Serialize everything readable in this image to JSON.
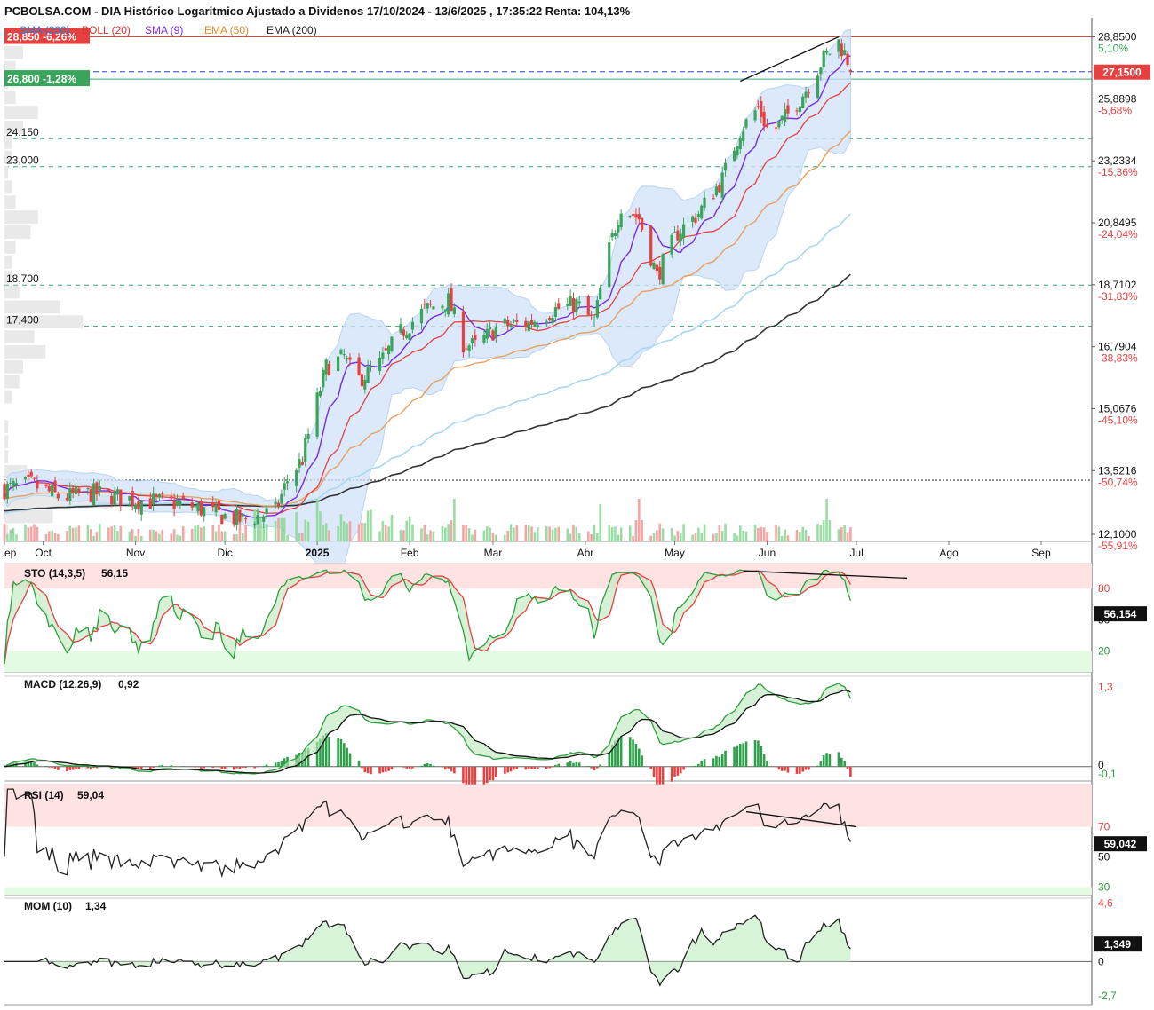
{
  "header": {
    "title": "PCBOLSA.COM - DIA Histórico Logaritmico Ajustado a Dividenos 17/10/2024 - 13/6/2025 , 17:35:22 Renta: 104,13%",
    "indicators": [
      {
        "label": "SMA (200)",
        "color": "#2a7fd4"
      },
      {
        "label": "BOLL (20)",
        "color": "#d6332f"
      },
      {
        "label": "SMA (9)",
        "color": "#7a2be2"
      },
      {
        "label": "EMA (50)",
        "color": "#e08a2a"
      },
      {
        "label": "EMA (200)",
        "color": "#222222"
      }
    ]
  },
  "colors": {
    "up": "#3aa55a",
    "down": "#e64040",
    "sma9": "#7a2be2",
    "boll_mid": "#e64040",
    "boll_band": "#cfe2f8",
    "ema50": "#e8a060",
    "sma200": "#a8d8f0",
    "ema200": "#333333",
    "stoch_k": "#2e9e3e",
    "stoch_d": "#e64040",
    "overbought": "#ffe3e3",
    "oversold": "#e3fbe3",
    "level_line": "#3aa57a"
  },
  "price_tags": {
    "resistance": {
      "price": 28.85,
      "text": "28,850 -6,26%",
      "color": "#e64040"
    },
    "support": {
      "price": 26.8,
      "text": "26,800 -1,28%",
      "color": "#3aa55a"
    },
    "last": {
      "price": 27.15,
      "text": "27,1500",
      "color": "#e64040"
    }
  },
  "levels": [
    {
      "price": 24.15,
      "text": "24,150"
    },
    {
      "price": 23.0,
      "text": "23,000"
    },
    {
      "price": 18.7,
      "text": "18,700"
    },
    {
      "price": 17.4,
      "text": "17,400"
    }
  ],
  "base_line": 13.3,
  "right_axis": [
    {
      "price": 28.85,
      "value": "28,8500",
      "pct": "5,10%",
      "pct_color": "#3aa55a"
    },
    {
      "price": 25.8898,
      "value": "25,8898",
      "pct": "-5,68%",
      "pct_color": "#e64040"
    },
    {
      "price": 23.2334,
      "value": "23,2334",
      "pct": "-15,36%",
      "pct_color": "#e64040"
    },
    {
      "price": 20.8495,
      "value": "20,8495",
      "pct": "-24,04%",
      "pct_color": "#e64040"
    },
    {
      "price": 18.7102,
      "value": "18,7102",
      "pct": "-31,83%",
      "pct_color": "#e64040"
    },
    {
      "price": 16.7904,
      "value": "16,7904",
      "pct": "-38,83%",
      "pct_color": "#e64040"
    },
    {
      "price": 15.0676,
      "value": "15,0676",
      "pct": "-45,10%",
      "pct_color": "#e64040"
    },
    {
      "price": 13.5216,
      "value": "13,5216",
      "pct": "-50,74%",
      "pct_color": "#e64040"
    },
    {
      "price": 12.1,
      "value": "12,1000",
      "pct": "-55,91%",
      "pct_color": "#e64040"
    }
  ],
  "x_axis": [
    {
      "label": "ep",
      "day": 0
    },
    {
      "label": "Oct",
      "day": 13
    },
    {
      "label": "Nov",
      "day": 44
    },
    {
      "label": "Dic",
      "day": 74
    },
    {
      "label": "2025",
      "day": 105,
      "bold": true
    },
    {
      "label": "Feb",
      "day": 136
    },
    {
      "label": "Mar",
      "day": 164
    },
    {
      "label": "Abr",
      "day": 195
    },
    {
      "label": "May",
      "day": 225
    },
    {
      "label": "Jun",
      "day": 256
    },
    {
      "label": "Jul",
      "day": 286
    },
    {
      "label": "Ago",
      "day": 317
    },
    {
      "label": "Sep",
      "day": 348
    }
  ],
  "panels": {
    "sto": {
      "label": "STO (14,3,5)",
      "value": "56,15",
      "tag": "56,154",
      "levels": [
        "80",
        "50",
        "20"
      ],
      "level_values": [
        80,
        50,
        20
      ]
    },
    "macd": {
      "label": "MACD (12,26,9)",
      "value": "0,92",
      "axis": [
        "1,3",
        "0",
        "-0,1"
      ],
      "axis_values": [
        1.3,
        0,
        -0.1
      ]
    },
    "rsi": {
      "label": "RSI (14)",
      "value": "59,04",
      "tag": "59,042",
      "levels": [
        "70",
        "50",
        "30"
      ],
      "level_values": [
        70,
        50,
        30
      ]
    },
    "mom": {
      "label": "MOM (10)",
      "value": "1,34",
      "tag": "1,349",
      "axis": [
        "4,6",
        "0",
        "-2,7"
      ],
      "axis_values": [
        4.6,
        0,
        -2.7
      ]
    }
  },
  "chart_data": {
    "type": "candlestick",
    "title": "PCBOLSA.COM - DIA Histórico Logaritmico Ajustado a Dividenos 17/10/2024 - 13/6/2025 , 17:35:22 Renta: 104,13%",
    "y_scale": "log",
    "ylim": [
      12.1,
      28.85
    ],
    "anchors": [
      {
        "date": "2024-09-01",
        "close": 13.1
      },
      {
        "date": "2024-09-10",
        "close": 13.2
      },
      {
        "date": "2024-09-20",
        "close": 12.9
      },
      {
        "date": "2024-10-01",
        "close": 13.0
      },
      {
        "date": "2024-10-15",
        "close": 12.85
      },
      {
        "date": "2024-11-01",
        "close": 12.75
      },
      {
        "date": "2024-11-10",
        "close": 12.55
      },
      {
        "date": "2024-11-20",
        "close": 12.4
      },
      {
        "date": "2024-12-01",
        "close": 12.6
      },
      {
        "date": "2024-12-05",
        "close": 13.3
      },
      {
        "date": "2024-12-10",
        "close": 13.8
      },
      {
        "date": "2024-12-14",
        "close": 15.0
      },
      {
        "date": "2024-12-18",
        "close": 16.2
      },
      {
        "date": "2024-12-24",
        "close": 16.5
      },
      {
        "date": "2024-12-28",
        "close": 15.8
      },
      {
        "date": "2025-01-05",
        "close": 16.3
      },
      {
        "date": "2025-01-12",
        "close": 17.2
      },
      {
        "date": "2025-01-20",
        "close": 17.9
      },
      {
        "date": "2025-01-28",
        "close": 18.2
      },
      {
        "date": "2025-02-02",
        "close": 16.9
      },
      {
        "date": "2025-02-06",
        "close": 16.8
      },
      {
        "date": "2025-02-14",
        "close": 17.4
      },
      {
        "date": "2025-02-24",
        "close": 17.5
      },
      {
        "date": "2025-03-04",
        "close": 17.9
      },
      {
        "date": "2025-03-12",
        "close": 18.1
      },
      {
        "date": "2025-03-18",
        "close": 17.5
      },
      {
        "date": "2025-03-22",
        "close": 19.5
      },
      {
        "date": "2025-03-27",
        "close": 21.5
      },
      {
        "date": "2025-04-02",
        "close": 21.0
      },
      {
        "date": "2025-04-08",
        "close": 19.0
      },
      {
        "date": "2025-04-15",
        "close": 20.5
      },
      {
        "date": "2025-04-22",
        "close": 21.2
      },
      {
        "date": "2025-04-30",
        "close": 22.5
      },
      {
        "date": "2025-05-06",
        "close": 24.5
      },
      {
        "date": "2025-05-12",
        "close": 25.5
      },
      {
        "date": "2025-05-16",
        "close": 24.3
      },
      {
        "date": "2025-05-22",
        "close": 25.2
      },
      {
        "date": "2025-05-28",
        "close": 26.3
      },
      {
        "date": "2025-06-03",
        "close": 27.8
      },
      {
        "date": "2025-06-08",
        "close": 28.6
      },
      {
        "date": "2025-06-13",
        "close": 27.15
      }
    ],
    "volume_spikes": [
      {
        "date": "2024-12-15",
        "volume": 4
      },
      {
        "date": "2025-01-30",
        "volume": 4
      },
      {
        "date": "2025-03-21",
        "volume": 7
      },
      {
        "date": "2025-04-02",
        "volume": 4
      },
      {
        "date": "2025-06-04",
        "volume": 4
      }
    ],
    "trendlines": [
      {
        "from": {
          "date": "2025-05-06",
          "price": 26.7
        },
        "to": {
          "date": "2025-06-08",
          "price": 28.85
        }
      },
      {
        "panel": "sto",
        "from": {
          "date": "2025-05-07",
          "value": 97
        },
        "to": {
          "date": "2025-07-01",
          "value": 90
        }
      },
      {
        "panel": "rsi",
        "from": {
          "date": "2025-05-08",
          "value": 80
        },
        "to": {
          "date": "2025-06-14",
          "value": 70
        }
      }
    ]
  }
}
